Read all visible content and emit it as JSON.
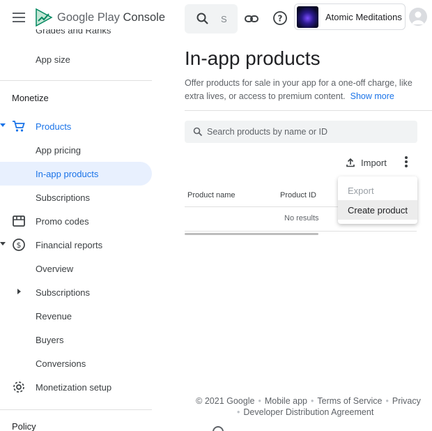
{
  "brand": {
    "google": "Google Play",
    "console": "Console"
  },
  "sidebar": {
    "clipped_item": "Grades and Ranks",
    "app_size": "App size",
    "monetize_title": "Monetize",
    "items": [
      {
        "label": "Products"
      },
      {
        "label": "App pricing"
      },
      {
        "label": "In-app products"
      },
      {
        "label": "Subscriptions"
      },
      {
        "label": "Promo codes"
      },
      {
        "label": "Financial reports"
      },
      {
        "label": "Overview"
      },
      {
        "label": "Subscriptions"
      },
      {
        "label": "Revenue"
      },
      {
        "label": "Buyers"
      },
      {
        "label": "Conversions"
      },
      {
        "label": "Monetization setup"
      }
    ],
    "policy_title": "Policy"
  },
  "topbar": {
    "search_placeholder": "S",
    "app_name": "Atomic Meditations"
  },
  "main": {
    "title": "In-app products",
    "description": "Offer products for sale in your app for a one-off charge, like extra lives, or access to premium content.",
    "show_more": "Show more",
    "search_placeholder": "Search products by name or ID",
    "import_label": "Import",
    "columns": [
      "Product name",
      "Product ID"
    ],
    "empty_text": "No results"
  },
  "menu": {
    "export": "Export",
    "create": "Create product"
  },
  "footer": {
    "copyright": "© 2021 Google",
    "mobile_app": "Mobile app",
    "terms": "Terms of Service",
    "privacy": "Privacy",
    "dda": "Developer Distribution Agreement"
  },
  "colors": {
    "accent": "#1a73e8",
    "active_bg": "#e8f0fe"
  }
}
